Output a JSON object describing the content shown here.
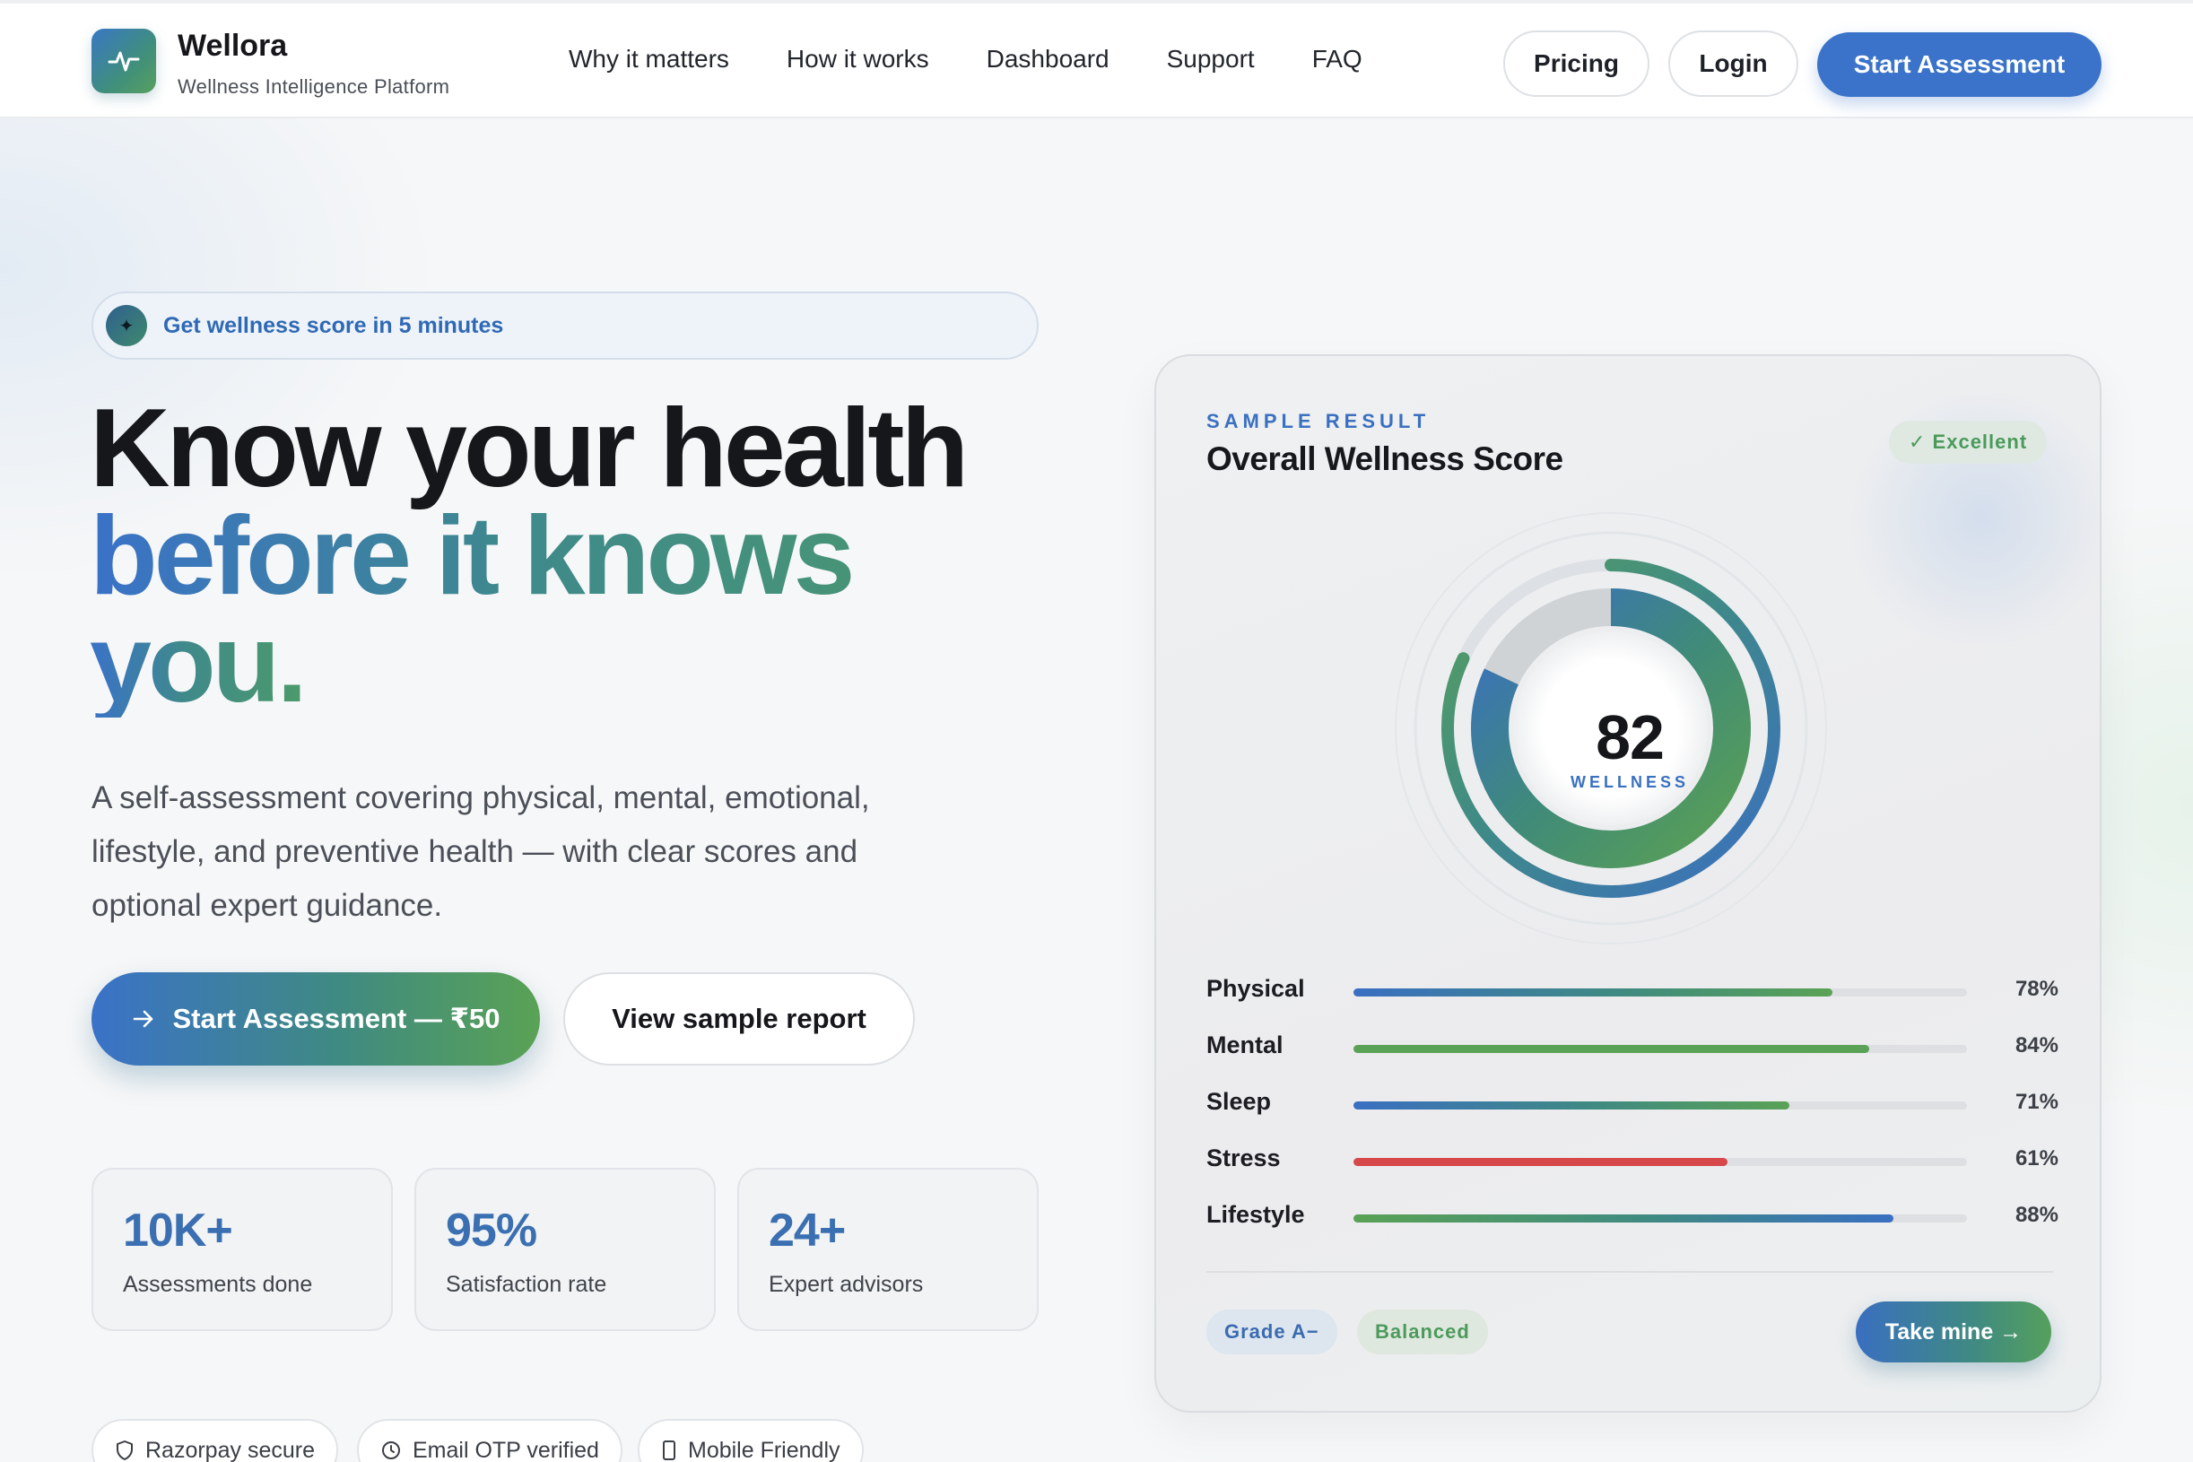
{
  "brand": {
    "name": "Wellora",
    "tagline": "Wellness Intelligence Platform",
    "accent": "#3a73c9",
    "accent_green": "#5aa255",
    "logo_icon": "pulse-icon"
  },
  "nav": {
    "items": [
      "Why it matters",
      "How it works",
      "Dashboard",
      "Support",
      "FAQ"
    ],
    "pricing": "Pricing",
    "login": "Login",
    "start": "Start Assessment"
  },
  "hero": {
    "badge": "Get wellness score in 5 minutes",
    "badge_icon": "sparkle-icon",
    "headline_line1": "Know your health",
    "headline_line2": "before it knows",
    "headline_line3": "you.",
    "subtitle": "A self-assessment covering physical, mental, emotional, lifestyle, and preventive health — with clear scores and optional expert guidance.",
    "cta_primary": "Start Assessment — ₹50",
    "cta_primary_icon": "arrow-right-icon",
    "cta_secondary": "View sample report"
  },
  "stats": [
    {
      "value": "10K+",
      "label": "Assessments done"
    },
    {
      "value": "95%",
      "label": "Satisfaction rate"
    },
    {
      "value": "24+",
      "label": "Expert advisors"
    }
  ],
  "trust": [
    {
      "label": "Razorpay secure",
      "icon": "shield-icon"
    },
    {
      "label": "Email OTP verified",
      "icon": "clock-icon"
    },
    {
      "label": "Mobile Friendly",
      "icon": "mobile-icon"
    }
  ],
  "result": {
    "eyebrow": "SAMPLE RESULT",
    "title": "Overall Wellness Score",
    "status": "✓ Excellent",
    "score": "82",
    "score_label": "WELLNESS",
    "score_value": 82,
    "metrics": [
      {
        "name": "Physical",
        "value": 78,
        "pct": "78%",
        "color": "blue-green"
      },
      {
        "name": "Mental",
        "value": 84,
        "pct": "84%",
        "color": "green"
      },
      {
        "name": "Sleep",
        "value": 71,
        "pct": "71%",
        "color": "blue-green"
      },
      {
        "name": "Stress",
        "value": 61,
        "pct": "61%",
        "color": "red"
      },
      {
        "name": "Lifestyle",
        "value": 88,
        "pct": "88%",
        "color": "green-blue"
      }
    ],
    "grade": "Grade A−",
    "balance": "Balanced",
    "take": "Take mine →"
  }
}
